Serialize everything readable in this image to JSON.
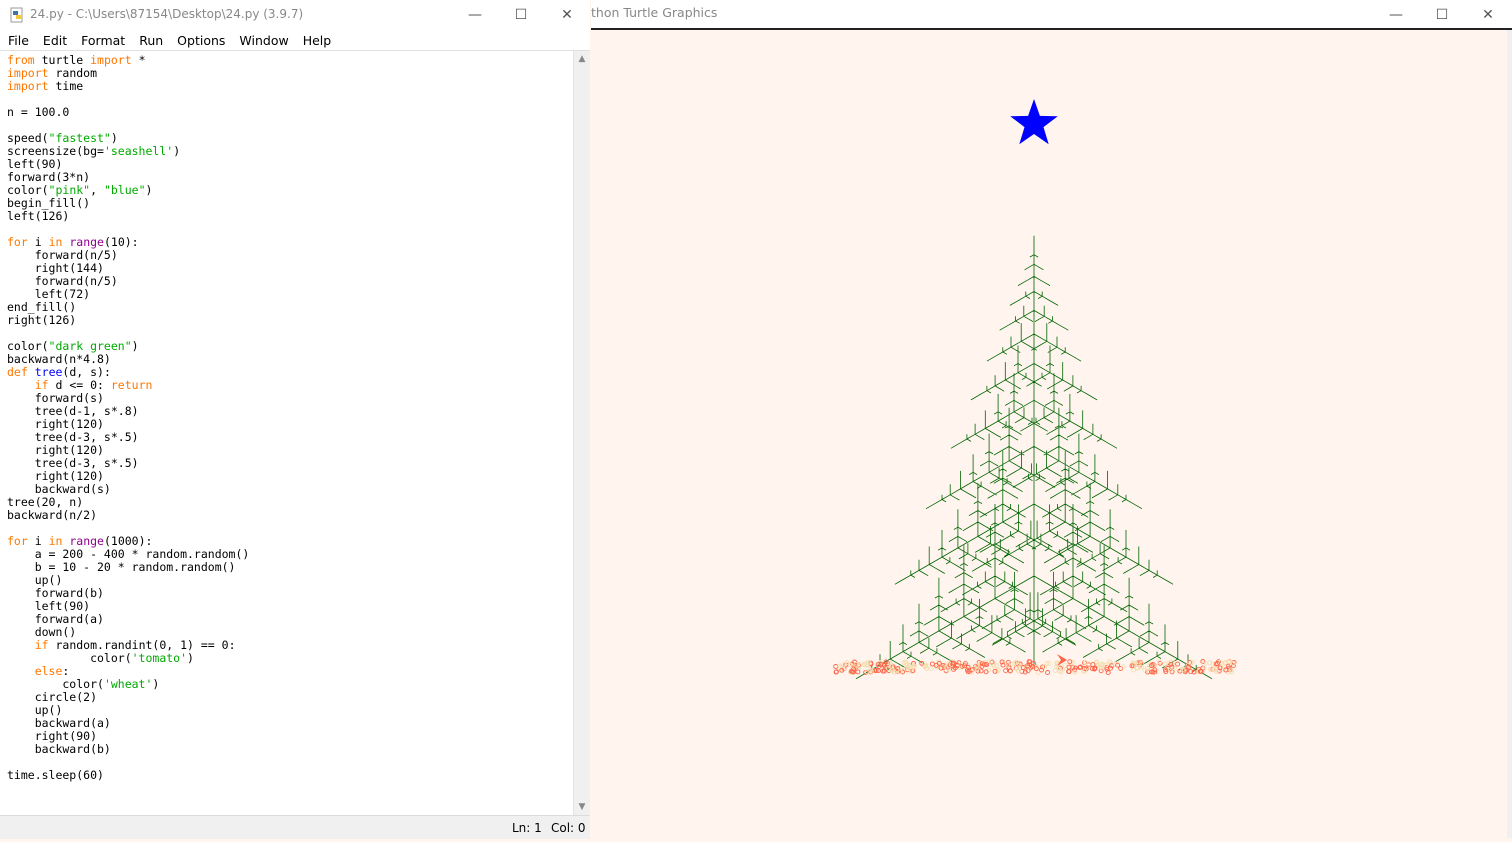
{
  "idle_window": {
    "title": "24.py - C:\\Users\\87154\\Desktop\\24.py (3.9.7)",
    "menu": [
      "File",
      "Edit",
      "Format",
      "Run",
      "Options",
      "Window",
      "Help"
    ],
    "status": {
      "line": "Ln: 1",
      "col": "Col: 0"
    },
    "code_lines": [
      "from turtle import *",
      "import random",
      "import time",
      "",
      "n = 100.0",
      "",
      "speed(\"fastest\")",
      "screensize(bg='seashell')",
      "left(90)",
      "forward(3*n)",
      "color(\"pink\", \"blue\")",
      "begin_fill()",
      "left(126)",
      "",
      "for i in range(10):",
      "    forward(n/5)",
      "    right(144)",
      "    forward(n/5)",
      "    left(72)",
      "end_fill()",
      "right(126)",
      "",
      "color(\"dark green\")",
      "backward(n*4.8)",
      "def tree(d, s):",
      "    if d <= 0: return",
      "    forward(s)",
      "    tree(d-1, s*.8)",
      "    right(120)",
      "    tree(d-3, s*.5)",
      "    right(120)",
      "    tree(d-3, s*.5)",
      "    right(120)",
      "    backward(s)",
      "tree(20, n)",
      "backward(n/2)",
      "",
      "for i in range(1000):",
      "    a = 200 - 400 * random.random()",
      "    b = 10 - 20 * random.random()",
      "    up()",
      "    forward(b)",
      "    left(90)",
      "    forward(a)",
      "    down()",
      "    if random.randint(0, 1) == 0:",
      "            color('tomato')",
      "    else:",
      "        color('wheat')",
      "    circle(2)",
      "    up()",
      "    backward(a)",
      "    right(90)",
      "    backward(b)",
      "",
      "time.sleep(60)"
    ]
  },
  "turtle_window": {
    "title": "thon Turtle Graphics",
    "background": "#fff5ee",
    "star_color": "#0000ff",
    "tree_color": "#006400",
    "ornament_colors": [
      "#ff6347",
      "#f5deb3"
    ]
  },
  "window_controls": {
    "minimize": "—",
    "maximize": "☐",
    "close": "✕"
  },
  "syntax_colors": {
    "keyword": "#ff7700",
    "builtin": "#900090",
    "string": "#00aa00",
    "def_name": "#0000ff"
  }
}
